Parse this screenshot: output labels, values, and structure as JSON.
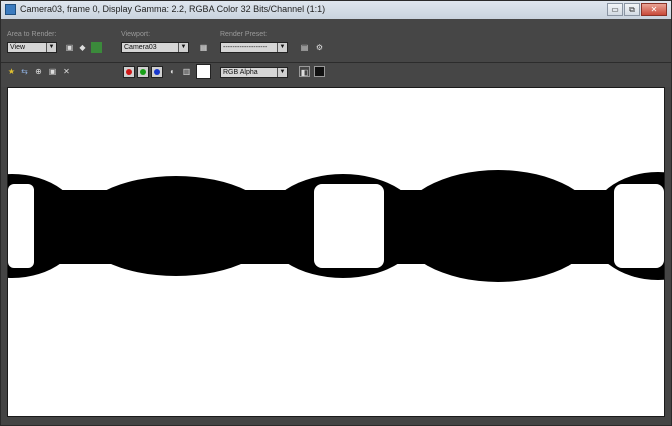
{
  "window": {
    "title": "Camera03, frame 0, Display Gamma: 2.2, RGBA Color 32 Bits/Channel (1:1)",
    "buttons": [
      "▭",
      "⧉",
      "✕"
    ]
  },
  "toolbar": {
    "area_label": "Area to Render:",
    "area_value": "View",
    "viewport_label": "Viewport:",
    "viewport_value": "Camera03",
    "preset_label": "Render Preset:",
    "preset_value": "-------------------",
    "channel_value": "RGB Alpha"
  },
  "colors": {
    "red": "#d01818",
    "green": "#18a018",
    "blue": "#1838d0",
    "render_bg": "#ffffff",
    "render_fg": "#000000"
  },
  "icons": [
    "render-region-icon",
    "edit-region-icon",
    "auto-region-icon",
    "lock-icon",
    "render-icon",
    "save-icon",
    "copy-icon",
    "clone-icon",
    "print-icon",
    "clear-icon",
    "mono-icon",
    "swatch-icon",
    "display-icon",
    "toggle-icon"
  ]
}
